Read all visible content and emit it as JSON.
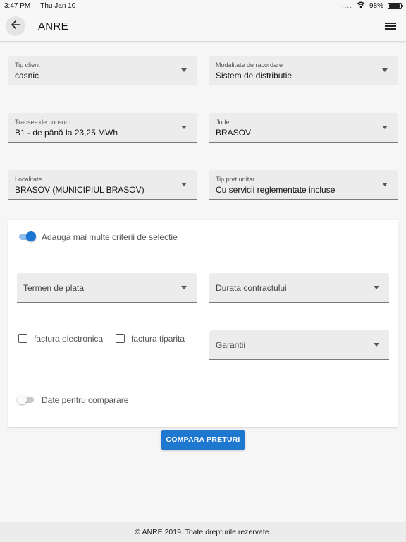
{
  "status_bar": {
    "time": "3:47 PM",
    "date": "Thu Jan 10",
    "signal": "....",
    "battery": "98%",
    "battery_level": 0.98
  },
  "app_bar": {
    "title": "ANRE",
    "back_icon": "arrow-left-icon",
    "menu_icon": "hamburger-menu-icon"
  },
  "filters": {
    "client_type": {
      "label": "Tip client",
      "value": "casnic"
    },
    "connection_mode": {
      "label": "Modalitate de racordare",
      "value": "Sistem de distributie"
    },
    "consumption_band": {
      "label": "Transee de consum",
      "value": "B1 - de până la 23,25 MWh"
    },
    "county": {
      "label": "Judet",
      "value": "BRASOV"
    },
    "locality": {
      "label": "Localitate",
      "value": "BRASOV (MUNICIPIUL BRASOV)"
    },
    "price_type": {
      "label": "Tip pret unitar",
      "value": "Cu servicii reglementate incluse"
    }
  },
  "advanced": {
    "toggle_label": "Adauga mai multe criterii de selectie",
    "toggle_on": true,
    "payment_term": {
      "placeholder": "Termen de plata"
    },
    "contract_duration": {
      "placeholder": "Durata contractului"
    },
    "electronic_invoice": {
      "label": "factura electronica",
      "checked": false
    },
    "printed_invoice": {
      "label": "factura tiparita",
      "checked": false
    },
    "guarantees": {
      "placeholder": "Garantii"
    },
    "compare_toggle_label": "Date pentru comparare",
    "compare_toggle_on": false
  },
  "compare_button": {
    "label": "COMPARA PRETURI"
  },
  "footer": {
    "text": "© ANRE 2019. Toate drepturile rezervate."
  },
  "colors": {
    "accent": "#1e78cf",
    "toggle_track_on": "#90bfee",
    "field_bg": "#ececec",
    "page_bg": "#f6f6f6"
  }
}
